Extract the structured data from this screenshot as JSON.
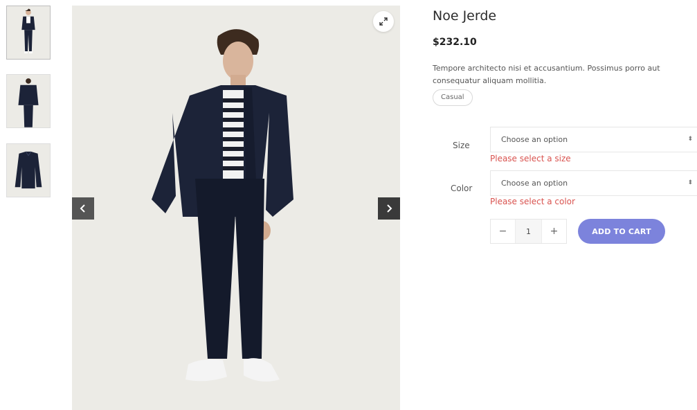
{
  "gallery": {
    "thumbnails": [
      {
        "name": "model-front-thumbnail"
      },
      {
        "name": "model-back-thumbnail"
      },
      {
        "name": "jacket-flat-thumbnail"
      }
    ],
    "zoom_icon": "expand-icon",
    "prev_icon": "chevron-left-icon",
    "next_icon": "chevron-right-icon"
  },
  "product": {
    "title": "Noe Jerde",
    "price": "$232.10",
    "description": "Tempore architecto nisi et accusantium. Possimus porro aut consequatur aliquam mollitia.",
    "tag": "Casual"
  },
  "options": {
    "size": {
      "label": "Size",
      "selected": "Choose an option",
      "error": "Please select a size"
    },
    "color": {
      "label": "Color",
      "selected": "Choose an option",
      "error": "Please select a color"
    }
  },
  "cart": {
    "minus": "−",
    "quantity": "1",
    "plus": "+",
    "add_label": "ADD TO CART"
  },
  "colors": {
    "accent": "#7c83dc",
    "error": "#d9534f",
    "jacket": "#1c2338"
  }
}
